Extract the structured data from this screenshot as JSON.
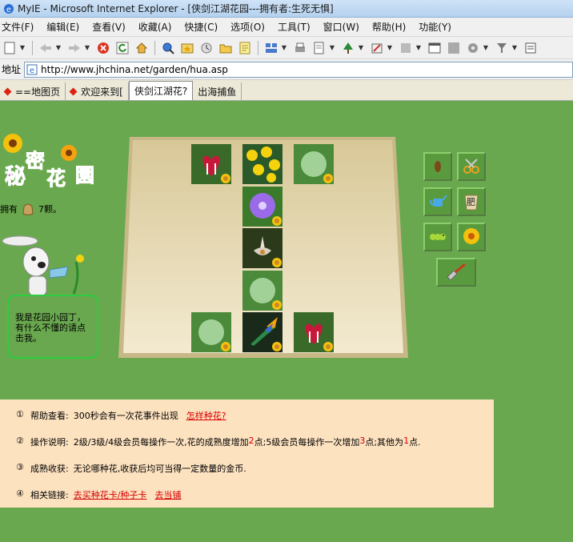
{
  "window": {
    "title": "MyIE - Microsoft Internet Explorer - [侠剑江湖花园---拥有者:生死无惧]"
  },
  "menu": {
    "items": [
      "文件(F)",
      "编辑(E)",
      "查看(V)",
      "收藏(A)",
      "快捷(C)",
      "选项(O)",
      "工具(T)",
      "窗口(W)",
      "帮助(H)",
      "功能(Y)"
    ]
  },
  "address": {
    "label": "地址",
    "url": "http://www.jhchina.net/garden/hua.asp"
  },
  "tabs": [
    {
      "label": "==地图页"
    },
    {
      "label": "欢迎来到["
    },
    {
      "label": "侠剑江湖花?"
    },
    {
      "label": "出海捕鱼"
    }
  ],
  "garden": {
    "own_prefix": "拥有",
    "own_count": "7颗。",
    "speech": "我是花园小园丁，有什么不懂的请点击我。"
  },
  "tools": [
    {
      "name": "seed",
      "icon": "seed-icon"
    },
    {
      "name": "scissors",
      "icon": "scissors-icon"
    },
    {
      "name": "watering-can",
      "icon": "watering-can-icon"
    },
    {
      "name": "fertilizer",
      "icon": "fertilizer-icon",
      "label": "肥"
    },
    {
      "name": "bug",
      "icon": "bug-icon"
    },
    {
      "name": "sunflower",
      "icon": "sunflower-icon"
    },
    {
      "name": "trowel",
      "icon": "trowel-icon"
    }
  ],
  "info": {
    "rows": [
      {
        "num": "①",
        "label": "帮助查看:",
        "text": "300秒会有一次花事件出现",
        "link": "怎样种花?"
      },
      {
        "num": "②",
        "label": "操作说明:",
        "text_a": "2级/3级/4级会员每操作一次,花的成熟度增加",
        "hl1": "2",
        "text_b": "点;5级会员每操作一次增加",
        "hl2": "3",
        "text_c": "点;其他为",
        "hl3": "1",
        "text_d": "点."
      },
      {
        "num": "③",
        "label": "成熟收获:",
        "text": "无论哪种花,收获后均可当得一定数量的金币."
      },
      {
        "num": "④",
        "label": "相关链接:",
        "link1": "去买种花卡/种子卡",
        "link2": "去当铺"
      }
    ]
  },
  "colors": {
    "page_bg": "#6aa84f",
    "board": "#e6d8b0",
    "info_bg": "#fde2c0",
    "link": "#d40000"
  }
}
